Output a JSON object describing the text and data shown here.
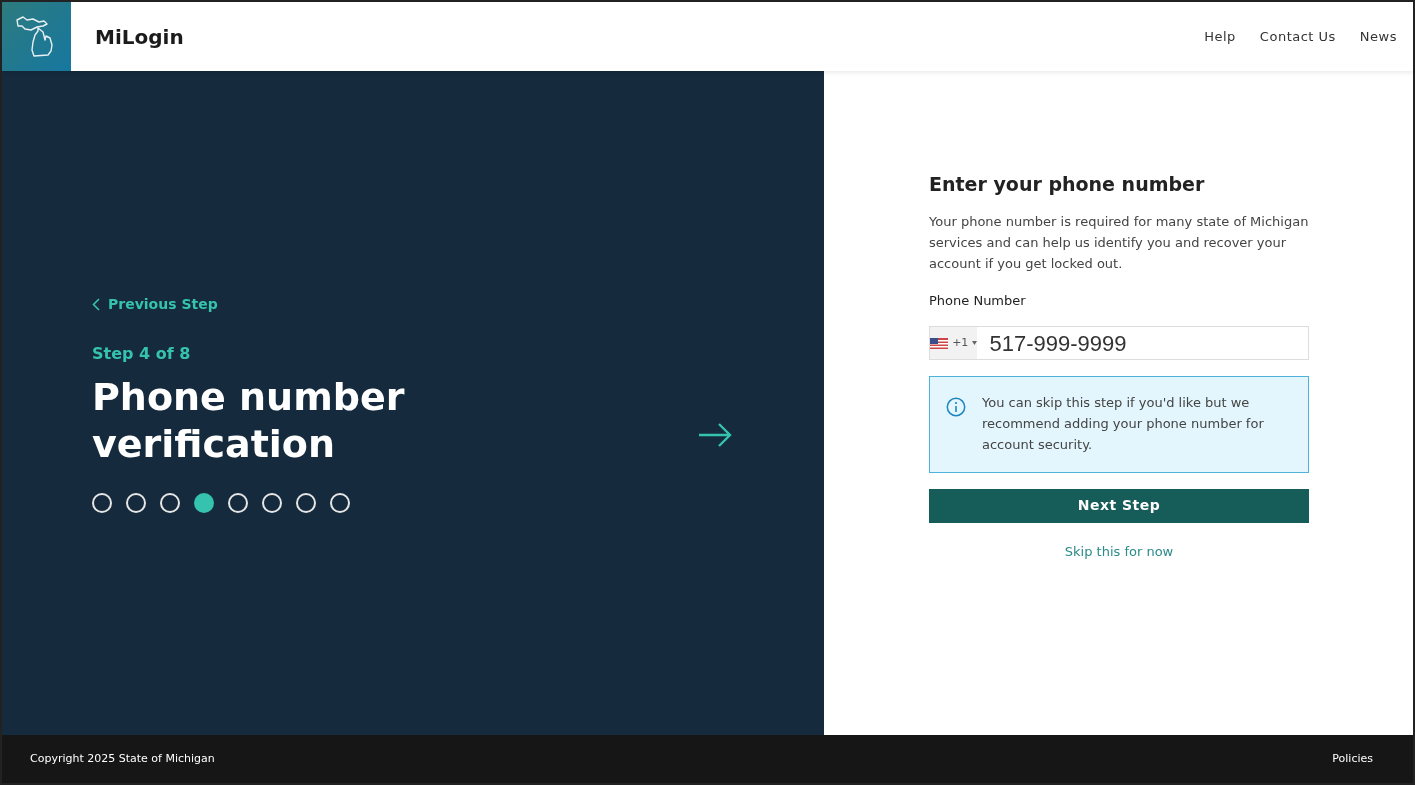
{
  "header": {
    "brand": "MiLogin",
    "links": [
      "Help",
      "Contact Us",
      "News"
    ]
  },
  "left": {
    "back": "Previous Step",
    "step": "Step 4 of 8",
    "title": "Phone number verification",
    "dots": [
      {
        "selected": false
      },
      {
        "selected": false
      },
      {
        "selected": false
      },
      {
        "selected": true
      },
      {
        "selected": false
      },
      {
        "selected": false
      },
      {
        "selected": false
      },
      {
        "selected": false
      }
    ]
  },
  "form": {
    "heading": "Enter your phone number",
    "description": "Your phone number is required for many state of Michigan services and can help us identify you and recover your account if you get locked out.",
    "label": "Phone Number",
    "country_code": "+1",
    "value": "517-999-9999",
    "notice": "You can skip this step if you'd like but we recommend adding your phone number for account security.",
    "button": "Next Step",
    "skip": "Skip this for now"
  },
  "footer": {
    "copyright": "Copyright 2025 State of Michigan",
    "link": "Policies"
  }
}
